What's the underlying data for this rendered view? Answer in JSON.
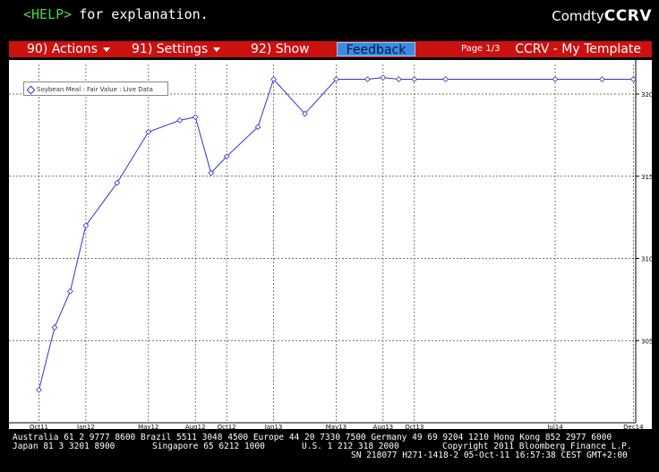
{
  "help": {
    "key": "<HELP>",
    "text": "for explanation."
  },
  "screen": {
    "prefix": "Comdty",
    "command": "CCRV"
  },
  "menu": {
    "actions": "90) Actions",
    "settings": "91) Settings",
    "show": "92) Show",
    "feedback": "Feedback",
    "page": "Page 1/3",
    "template": "CCRV - My Template"
  },
  "legend": {
    "label": "Soybean Meal : Fair Value : Live Data"
  },
  "colors": {
    "accent_red": "#cc1111",
    "series": "#3333cc",
    "help_green": "#4fd34f",
    "feedback": "#3b8be3"
  },
  "chart_data": {
    "type": "line",
    "series": [
      {
        "name": "Soybean Meal : Fair Value : Live Data",
        "x": [
          "Oct11",
          "Nov11",
          "Dec11",
          "Jan12",
          "Mar12",
          "May12",
          "Jul12",
          "Aug12",
          "Sep12",
          "Oct12",
          "Dec12",
          "Jan13",
          "Mar13",
          "May13",
          "Jul13",
          "Aug13",
          "Sep13",
          "Oct13",
          "Dec13",
          "Jul14",
          "Oct14",
          "Dec14"
        ],
        "values": [
          302.0,
          305.8,
          308.0,
          312.0,
          314.6,
          317.7,
          318.4,
          318.6,
          315.2,
          316.2,
          318.0,
          320.9,
          318.8,
          320.9,
          320.9,
          321.0,
          320.9,
          320.9,
          320.9,
          320.9,
          320.9,
          320.9
        ]
      }
    ],
    "x_ticks": [
      "Oct11",
      "Jan12",
      "May12",
      "Aug12",
      "Oct12",
      "Jan13",
      "May13",
      "Aug13",
      "Oct13",
      "Jul14",
      "Dec14"
    ],
    "y_ticks": [
      305,
      310,
      315,
      320
    ],
    "ylim": [
      300.0,
      321.8
    ],
    "grid": true,
    "legend_position": "top-left"
  },
  "footer": {
    "line1": "Australia 61 2 9777 8600 Brazil 5511 3048 4500 Europe 44 20 7330 7500 Germany 49 69 9204 1210 Hong Kong 852 2977 6000",
    "line2a": "Japan 81 3 3201 8900",
    "line2b": "Singapore 65 6212 1000",
    "line2c": "U.S. 1 212 318 2000",
    "line2d": "Copyright 2011 Bloomberg Finance L.P.",
    "line3": "SN 218077 H271-1418-2 05-Oct-11 16:57:38 CEST GMT+2:00"
  }
}
